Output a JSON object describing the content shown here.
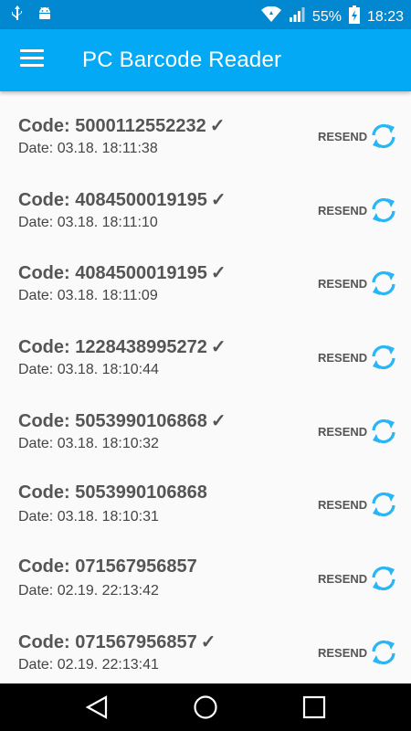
{
  "status_bar": {
    "battery": "55%",
    "time": "18:23",
    "icons": [
      "usb-icon",
      "android-debug-icon",
      "wifi-icon",
      "signal-icon",
      "battery-charging-icon"
    ]
  },
  "app_bar": {
    "title": "PC Barcode Reader",
    "menu_icon": "hamburger-menu-icon"
  },
  "list": {
    "items": [
      {
        "code": "Code: 5000112552232",
        "check": "✓",
        "date": "Date: 03.18. 18:11:38",
        "resend_label": "RESEND"
      },
      {
        "code": "Code: 4084500019195",
        "check": "✓",
        "date": "Date: 03.18. 18:11:10",
        "resend_label": "RESEND"
      },
      {
        "code": "Code: 4084500019195",
        "check": "✓",
        "date": "Date: 03.18. 18:11:09",
        "resend_label": "RESEND"
      },
      {
        "code": "Code: 1228438995272",
        "check": "✓",
        "date": "Date: 03.18. 18:10:44",
        "resend_label": "RESEND"
      },
      {
        "code": "Code: 5053990106868",
        "check": "✓",
        "date": "Date: 03.18. 18:10:32",
        "resend_label": "RESEND"
      },
      {
        "code": "Code: 5053990106868",
        "check": "",
        "date": "Date: 03.18. 18:10:31",
        "resend_label": "RESEND"
      },
      {
        "code": "Code: 071567956857",
        "check": "",
        "date": "Date: 02.19. 22:13:42",
        "resend_label": "RESEND"
      },
      {
        "code": "Code: 071567956857",
        "check": "✓",
        "date": "Date: 02.19. 22:13:41",
        "resend_label": "RESEND"
      }
    ]
  },
  "colors": {
    "status_bar": "#0288d1",
    "app_bar": "#03a9f4",
    "resend_icon": "#29b6f6"
  },
  "nav_bar": {
    "icons": [
      "back-icon",
      "home-icon",
      "recents-icon"
    ]
  }
}
